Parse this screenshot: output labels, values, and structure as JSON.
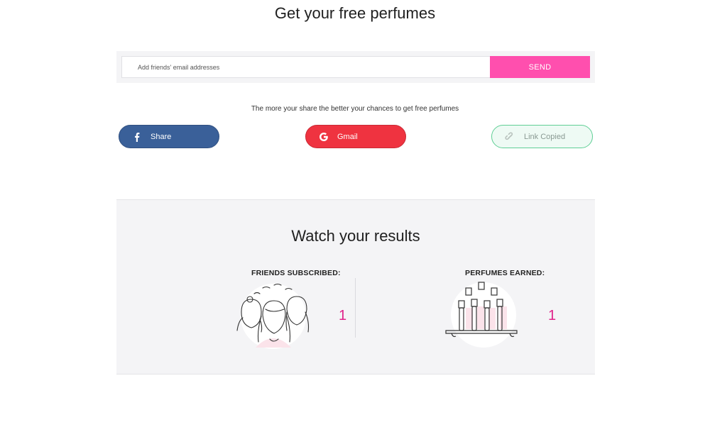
{
  "header": {
    "title": "Get your free perfumes"
  },
  "invite": {
    "email_placeholder": "Add friends' email addresses",
    "send_label": "SEND"
  },
  "share": {
    "hint": "The more your share the better your chances to get free perfumes",
    "buttons": {
      "facebook": "Share",
      "gmail": "Gmail",
      "copy": "Link Copied"
    }
  },
  "results": {
    "title": "Watch your results",
    "friends": {
      "label": "FRIENDS SUBSCRIBED:",
      "value": "1"
    },
    "perfumes": {
      "label": "PERFUMES EARNED:",
      "value": "1"
    }
  },
  "colors": {
    "accent_pink": "#ff4fae",
    "facebook_blue": "#3a6099",
    "gmail_red": "#ef3340",
    "copied_green": "#5fcf95",
    "stat_magenta": "#e0238a"
  },
  "icons": {
    "facebook": "facebook-icon",
    "gmail": "google-icon",
    "copy": "link-icon",
    "friends": "friends-illustration",
    "perfumes": "perfumes-illustration"
  }
}
